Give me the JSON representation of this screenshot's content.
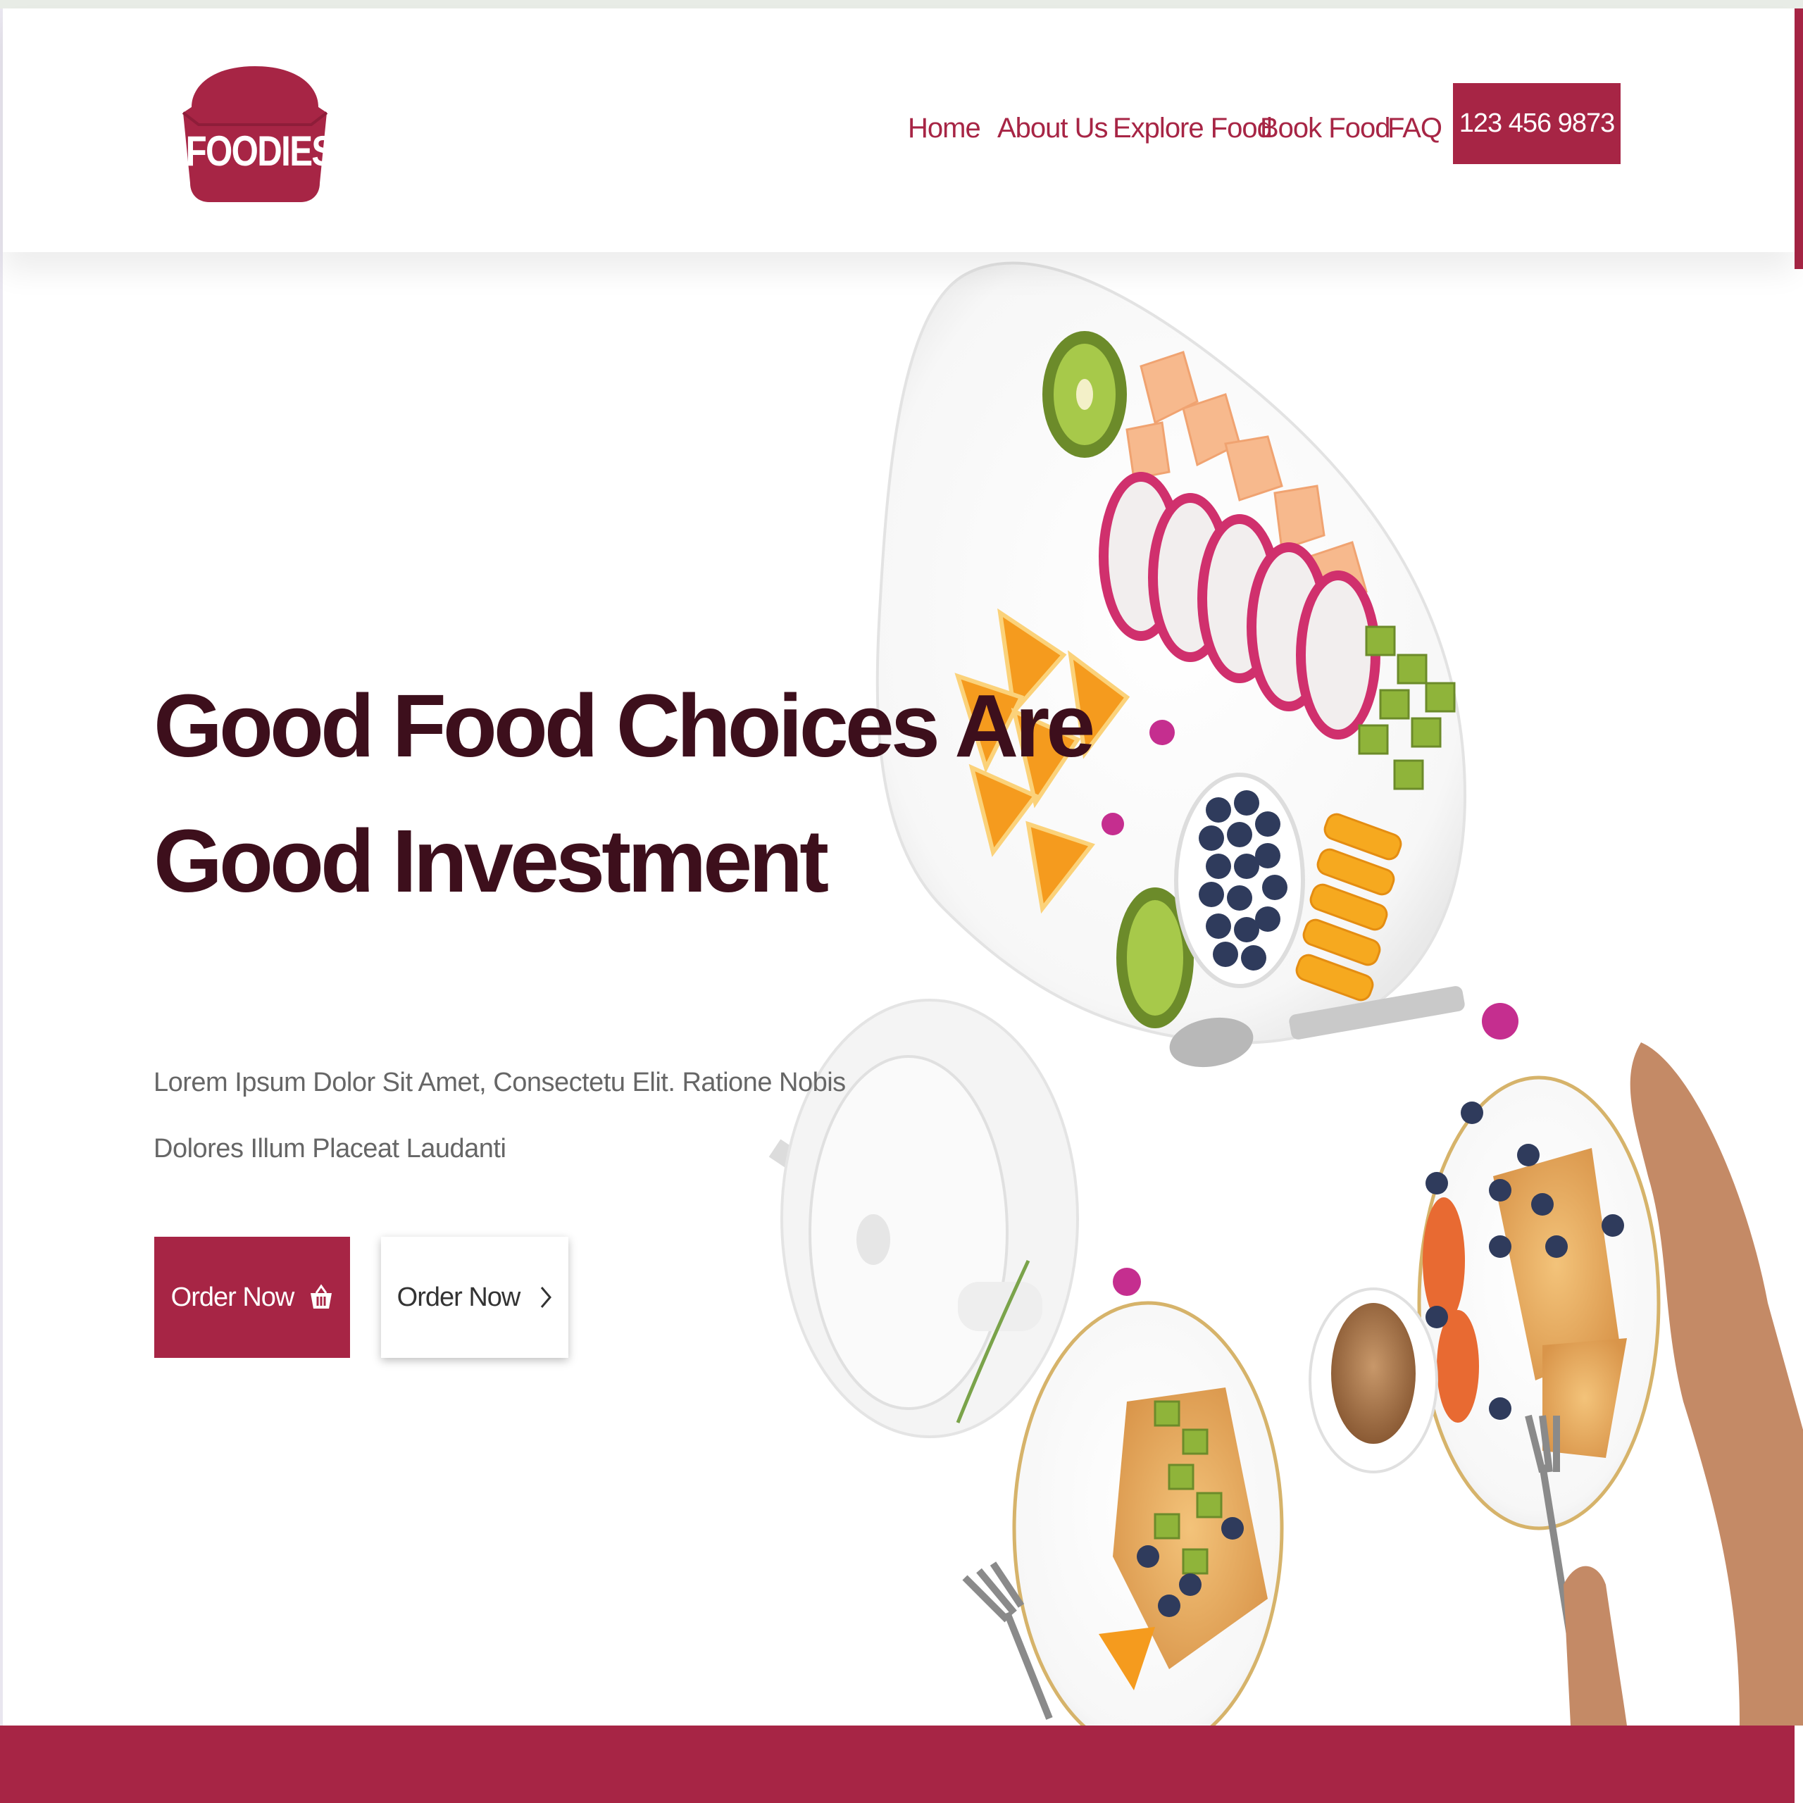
{
  "brand": {
    "logo_text": "FOODIES",
    "primary_color": "#a72545",
    "headline_color": "#3d0f1c"
  },
  "nav": {
    "items": [
      {
        "label": "Home"
      },
      {
        "label": "About Us"
      },
      {
        "label": "Explore Food"
      },
      {
        "label": "Book Food"
      },
      {
        "label": "FAQ"
      }
    ],
    "phone": "123 456 9873"
  },
  "hero": {
    "headline_line1": "Good Food Choices Are",
    "headline_line2": "Good Investment",
    "subtext_line1": "Lorem Ipsum Dolor Sit Amet, Consectetu Elit. Ratione Nobis",
    "subtext_line2": "Dolores Illum Placeat Laudanti",
    "primary_button": {
      "label": "Order Now",
      "icon": "shopping-basket-icon"
    },
    "secondary_button": {
      "label": "Order Now",
      "icon": "chevron-right-icon"
    }
  }
}
